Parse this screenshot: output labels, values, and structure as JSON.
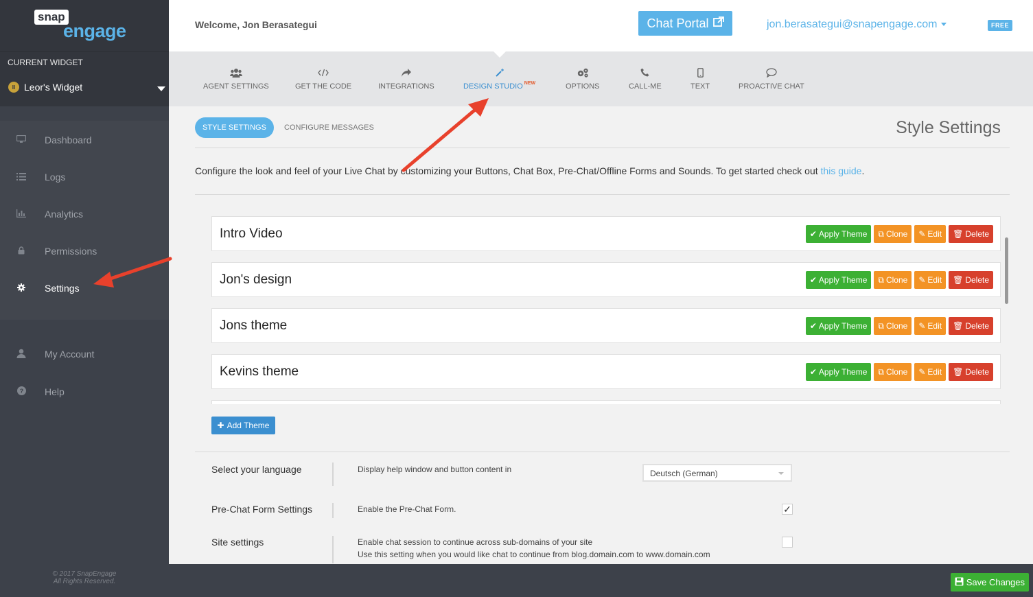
{
  "brand": {
    "logo_top": "snap",
    "logo_bottom": "engage"
  },
  "sidebar": {
    "current_widget_label": "CURRENT WIDGET",
    "widget_name": "Leor's Widget",
    "items": [
      {
        "label": "Dashboard",
        "icon": "monitor-icon"
      },
      {
        "label": "Logs",
        "icon": "list-icon"
      },
      {
        "label": "Analytics",
        "icon": "bar-chart-icon"
      },
      {
        "label": "Permissions",
        "icon": "lock-icon"
      },
      {
        "label": "Settings",
        "icon": "gear-icon",
        "active": true
      },
      {
        "label": "My Account",
        "icon": "user-icon"
      },
      {
        "label": "Help",
        "icon": "question-icon"
      }
    ],
    "copyright_line1": "© 2017 SnapEngage",
    "copyright_line2": "All Rights Reserved."
  },
  "header": {
    "welcome": "Welcome, Jon Berasategui",
    "portal_button": "Chat Portal",
    "email": "jon.berasategui@snapengage.com",
    "plan_badge": "FREE"
  },
  "tabs": [
    {
      "label": "AGENT SETTINGS",
      "icon": "users-icon"
    },
    {
      "label": "GET THE CODE",
      "icon": "code-icon"
    },
    {
      "label": "INTEGRATIONS",
      "icon": "share-icon"
    },
    {
      "label": "DESIGN STUDIO",
      "icon": "magic-wand-icon",
      "badge": "NEW",
      "active": true
    },
    {
      "label": "OPTIONS",
      "icon": "cogs-icon"
    },
    {
      "label": "CALL-ME",
      "icon": "phone-icon"
    },
    {
      "label": "TEXT",
      "icon": "mobile-icon"
    },
    {
      "label": "PROACTIVE CHAT",
      "icon": "chat-bubble-icon"
    }
  ],
  "subtabs": {
    "active": "STYLE SETTINGS",
    "other": "CONFIGURE MESSAGES"
  },
  "page_title": "Style Settings",
  "intro": {
    "text": "Configure the look and feel of your Live Chat by customizing your Buttons, Chat Box, Pre-Chat/Offline Forms and Sounds. To get started check out ",
    "link": "this guide",
    "end": "."
  },
  "theme_buttons": {
    "apply": "Apply Theme",
    "clone": "Clone",
    "edit": "Edit",
    "delete": "Delete"
  },
  "themes": [
    {
      "name": "Intro Video"
    },
    {
      "name": "Jon's design"
    },
    {
      "name": "Jons theme"
    },
    {
      "name": "Kevins theme"
    }
  ],
  "add_theme": "Add Theme",
  "settings": {
    "language": {
      "label": "Select your language",
      "desc": "Display help window and button content in",
      "value": "Deutsch (German)"
    },
    "prechat": {
      "label": "Pre-Chat Form Settings",
      "desc": "Enable the Pre-Chat Form.",
      "checked": true,
      "check_glyph": "✓"
    },
    "site": {
      "label": "Site settings",
      "desc1": "Enable chat session to continue across sub-domains of your site",
      "desc2": "Use this setting when you would like chat to continue from blog.domain.com to www.domain.com",
      "checked": false
    }
  },
  "footer": {
    "save": "Save Changes"
  },
  "colors": {
    "accent": "#5bb3e8",
    "sidebar": "#3d414a",
    "apply": "#3cb034",
    "clone_edit": "#f39325",
    "delete": "#d7402c",
    "arrow": "#e8412c"
  }
}
